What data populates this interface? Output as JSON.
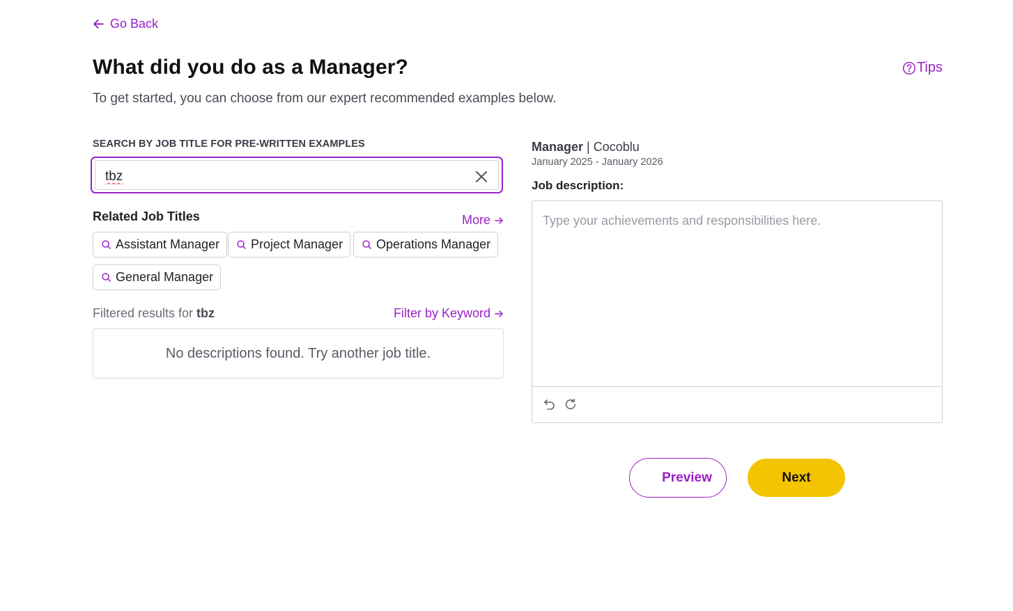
{
  "nav": {
    "go_back_label": "Go Back"
  },
  "header": {
    "title": "What did you do as a Manager?",
    "subtitle": "To get started, you can choose from our expert recommended examples below.",
    "tips_label": "Tips"
  },
  "search": {
    "label": "SEARCH BY JOB TITLE FOR PRE-WRITTEN EXAMPLES",
    "value": "tbz"
  },
  "related": {
    "title": "Related Job Titles",
    "more_label": "More",
    "chips": [
      "Assistant Manager",
      "Project Manager",
      "Operations Manager",
      "General Manager"
    ]
  },
  "results": {
    "filtered_prefix": "Filtered results for ",
    "filtered_term": "tbz",
    "filter_by_keyword_label": "Filter by Keyword",
    "empty_message": "No descriptions found. Try another job title."
  },
  "job": {
    "title": "Manager",
    "separator": " | ",
    "company": "Cocoblu",
    "dates": "January 2025 - January 2026",
    "description_label": "Job description:",
    "description_placeholder": "Type your achievements and responsibilities here."
  },
  "actions": {
    "preview_label": "Preview",
    "next_label": "Next"
  },
  "colors": {
    "accent": "#9b20c9",
    "primary_button": "#f5c400"
  },
  "icons": [
    "arrow-left-icon",
    "help-circle-icon",
    "close-icon",
    "search-icon",
    "arrow-right-icon",
    "undo-icon",
    "redo-icon"
  ]
}
